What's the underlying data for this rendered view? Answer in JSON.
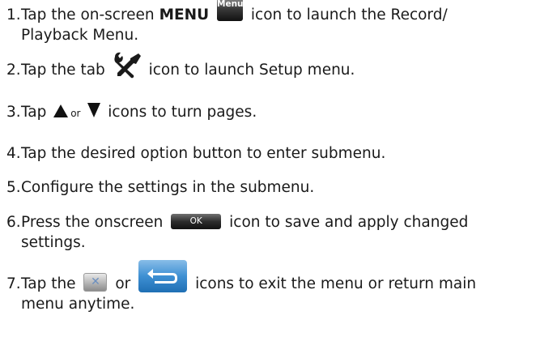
{
  "steps": [
    {
      "num": "1.",
      "before": "Tap the on-screen",
      "keyword": "MENU",
      "icon_menu_label": "Menu",
      "after": "icon to launch the Record/",
      "cont": "Playback Menu."
    },
    {
      "num": "2.",
      "before": "Tap the tab",
      "icon": "wrench-screwdriver-icon",
      "after": "icon to launch Setup menu."
    },
    {
      "num": "3.",
      "before": "Tap",
      "icon_up": "up-triangle-icon",
      "or": "or",
      "icon_down": "down-triangle-icon",
      "after": "icons to turn pages."
    },
    {
      "num": "4.",
      "text": "Tap the desired option button to enter submenu."
    },
    {
      "num": "5.",
      "text": "Configure the settings in the submenu."
    },
    {
      "num": "6.",
      "before": "Press the onscreen",
      "icon_ok_label": "OK",
      "after": "icon to save and apply changed",
      "cont": "settings."
    },
    {
      "num": "7.",
      "before": "Tap the",
      "icon_close": "close-icon",
      "or": "or",
      "icon_return": "return-icon",
      "after": "icons to exit the menu or return main",
      "cont": "menu anytime."
    }
  ],
  "colors": {
    "text": "#1a1a1a",
    "return_button": "#3f90d3",
    "ok_button": "#2d2d2d"
  }
}
